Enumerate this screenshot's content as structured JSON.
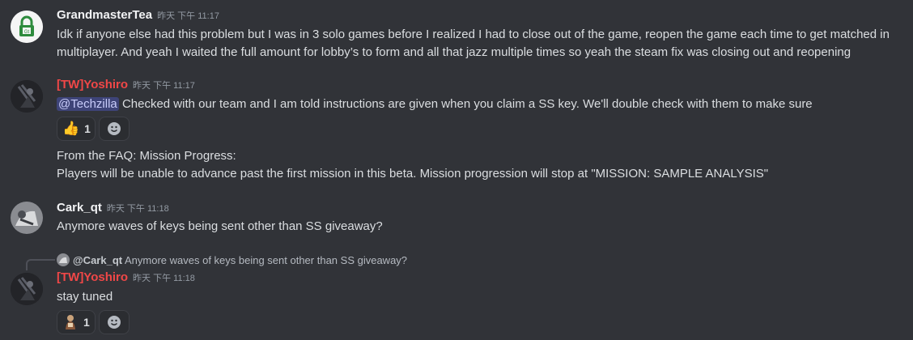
{
  "colors": {
    "background": "#313338",
    "username_default": "#f2f3f5",
    "username_red": "#f04747",
    "mention_bg": "#5865f2",
    "timestamp": "#949ba4"
  },
  "messages": [
    {
      "author": "GrandmasterTea",
      "timestamp": "昨天 下午 11:17",
      "avatar_icon": "green-lock-avatar-icon",
      "lines": [
        "Idk if anyone else had this problem but I was in 3 solo games before I realized I had to close out of the game, reopen the game each time to get matched in",
        "multiplayer. And yeah I waited the full amount for lobby’s to form and all that jazz multiple times so yeah the steam fix was closing out and reopening"
      ]
    },
    {
      "author": "[TW]Yoshiro",
      "timestamp": "昨天 下午 11:17",
      "avatar_icon": "dark-character-avatar-icon",
      "mention": "@Techzilla",
      "text": "Checked with our team and I am told instructions are given when you claim a SS key. We'll double check with them to make sure",
      "reaction": {
        "emoji": "👍",
        "count": "1"
      },
      "followup_lines": [
        "From the FAQ: Mission Progress:",
        "Players will be unable to advance past the first mission in this beta. Mission progression will stop at \"MISSION: SAMPLE ANALYSIS\""
      ]
    },
    {
      "author": "Cark_qt",
      "timestamp": "昨天 下午 11:18",
      "avatar_icon": "grey-photo-avatar-icon",
      "text": "Anymore waves of keys being sent other than SS giveaway?"
    },
    {
      "author": "[TW]Yoshiro",
      "timestamp": "昨天 下午 11:18",
      "avatar_icon": "dark-character-avatar-icon",
      "reply_to": {
        "author": "@Cark_qt",
        "text": "Anymore waves of keys being sent other than SS giveaway?"
      },
      "text": "stay tuned",
      "reaction": {
        "emoji_icon": "figure-emoji-icon",
        "count": "1"
      }
    }
  ]
}
